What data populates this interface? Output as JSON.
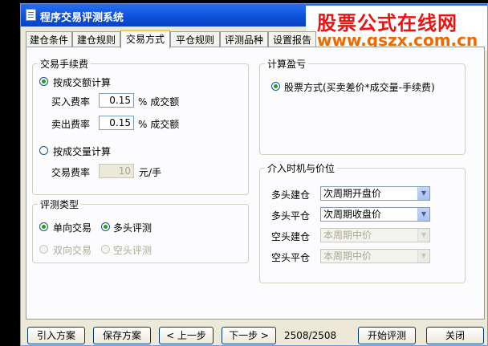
{
  "window": {
    "title": "程序交易评测系统"
  },
  "watermark": {
    "line1": "股票公式在线网",
    "line2": "www.gszx.com.cn"
  },
  "tabs": [
    {
      "label": "建仓条件"
    },
    {
      "label": "建仓规则"
    },
    {
      "label": "交易方式"
    },
    {
      "label": "平仓规则"
    },
    {
      "label": "评测品种"
    },
    {
      "label": "设置报告"
    }
  ],
  "fee": {
    "legend": "交易手续费",
    "by_amount_label": "按成交额计算",
    "buy_label": "买入费率",
    "buy_value": "0.15",
    "buy_unit": "% 成交额",
    "sell_label": "卖出费率",
    "sell_value": "0.15",
    "sell_unit": "% 成交额",
    "by_volume_label": "按成交量计算",
    "rate_label": "交易费率",
    "rate_value": "10",
    "rate_unit": "元/手"
  },
  "eval_type": {
    "legend": "评测类型",
    "one_way": "单向交易",
    "multi_head": "多头评测",
    "two_way": "双向交易",
    "short_head": "空头评测"
  },
  "pnl": {
    "legend": "计算盈亏",
    "stock_method": "股票方式(买卖差价*成交量-手续费)"
  },
  "timing": {
    "legend": "介入时机与价位",
    "rows": [
      {
        "label": "多头建仓",
        "value": "次周期开盘价"
      },
      {
        "label": "多头平仓",
        "value": "次周期收盘价"
      },
      {
        "label": "空头建仓",
        "value": "本周期中价"
      },
      {
        "label": "空头平仓",
        "value": "本周期中价"
      }
    ]
  },
  "footer": {
    "import": "引入方案",
    "save": "保存方案",
    "prev": "< 上一步",
    "next": "下一步 >",
    "counter": "2508/2508",
    "start": "开始评测",
    "close": "关闭"
  }
}
